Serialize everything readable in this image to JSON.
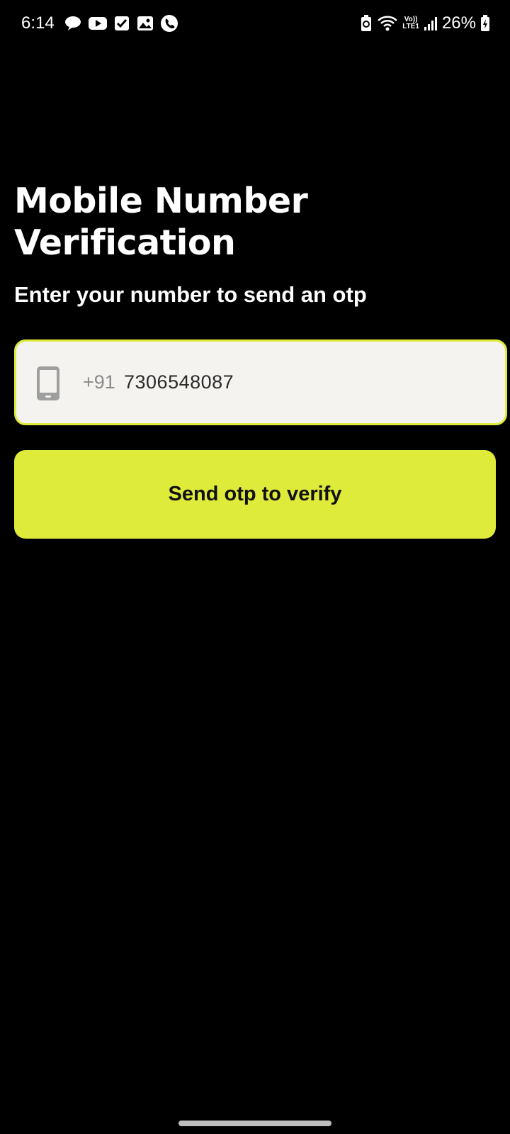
{
  "status_bar": {
    "time": "6:14",
    "left_icons": [
      "chat-bubble-icon",
      "youtube-icon",
      "checkbox-icon",
      "gallery-icon",
      "phone-call-icon"
    ],
    "right_icons": [
      "battery-saver-icon",
      "wifi-icon",
      "volte-icon",
      "signal-icon",
      "battery-charging-icon"
    ],
    "volte_top": "Vo))",
    "volte_bottom": "LTE1",
    "battery_percent": "26%"
  },
  "page": {
    "title": "Mobile Number Verification",
    "subtitle": "Enter your number to send an otp"
  },
  "phone_field": {
    "icon": "smartphone-icon",
    "country_code": "+91",
    "value": "7306548087"
  },
  "send_button": {
    "label": "Send otp to verify"
  },
  "colors": {
    "background": "#000000",
    "accent": "#dfeb3a",
    "field_background": "#f4f3ef",
    "text_primary": "#ffffff",
    "button_text": "#111111",
    "placeholder_grey": "#8a8a8a"
  }
}
